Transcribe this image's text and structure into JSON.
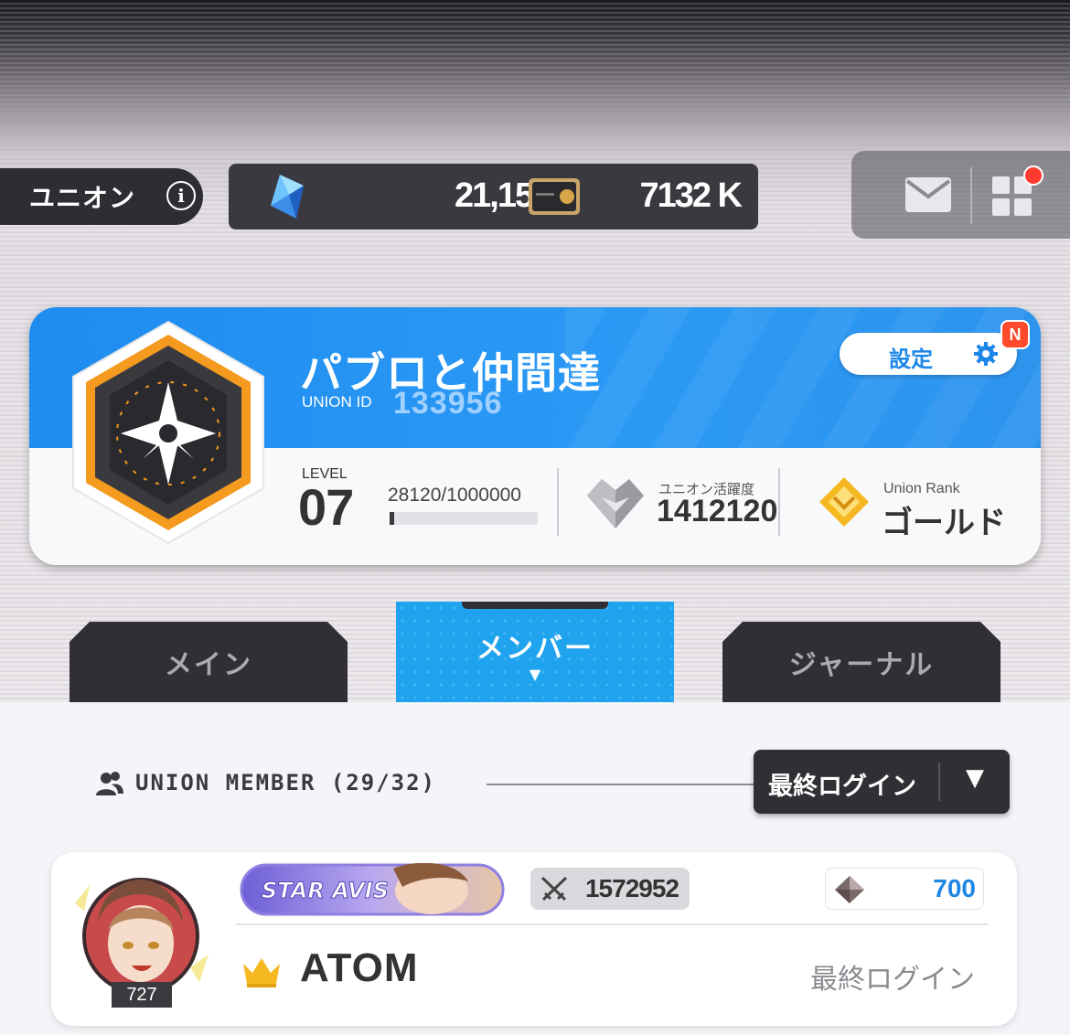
{
  "header": {
    "title": "ユニオン",
    "gems": "21,156",
    "gems_plus": "+",
    "credits": "7132 K"
  },
  "union": {
    "name": "パブロと仲間達",
    "id_label": "UNION ID",
    "id": "133956",
    "settings_label": "設定",
    "settings_badge": "N",
    "level_label": "LEVEL",
    "level": "07",
    "exp": "28120/1000000",
    "exp_progress": 0.028,
    "activity_label": "ユニオン活躍度",
    "activity_value": "1412120",
    "rank_label": "Union Rank",
    "rank_value": "ゴールド"
  },
  "tabs": {
    "main": "メイン",
    "members": "メンバー",
    "members_caret": "▼",
    "journal": "ジャーナル"
  },
  "members_section": {
    "title": "UNION MEMBER (29/32)",
    "sort_label": "最終ログイン",
    "sort_arrow": "▼"
  },
  "member": {
    "avatar_level": "727",
    "power": "1572952",
    "contribution": "700",
    "name": "ATOM",
    "last_login": "最終ログイン",
    "banner_text": "STAR AVIS"
  },
  "colors": {
    "accent_blue": "#1fa3ee",
    "dark": "#2f2f34",
    "gold": "#f5b820",
    "orange": "#f39a1f"
  }
}
